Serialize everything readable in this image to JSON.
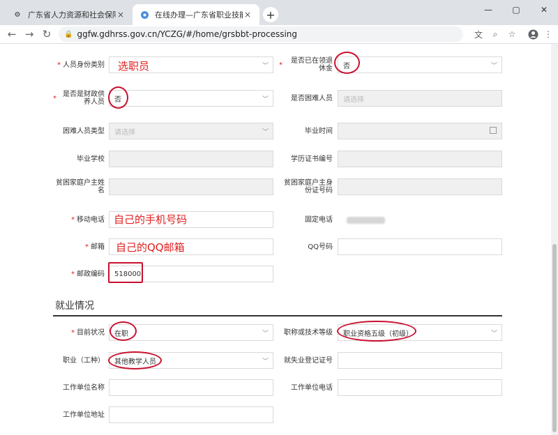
{
  "browser": {
    "tabs": [
      {
        "title": "广东省人力资源和社会保障厅网...",
        "icon": "gear-icon",
        "active": false
      },
      {
        "title": "在线办理—广东省职业技能提升...",
        "icon": "flower-icon",
        "active": true
      }
    ],
    "url": "ggfw.gdhrss.gov.cn/YCZG/#/home/grsbbt-processing"
  },
  "form": {
    "rows": [
      {
        "left": {
          "label": "人员身份类别",
          "required": true,
          "value": "",
          "placeholder": "",
          "type": "select"
        },
        "right": {
          "label": "是否已在领退休金",
          "required": true,
          "value": "否",
          "type": "select"
        }
      },
      {
        "left": {
          "label": "是否是财政供养人员",
          "required": true,
          "value": "否",
          "type": "select"
        },
        "right": {
          "label": "是否困难人员",
          "required": false,
          "value": "",
          "placeholder": "请选择",
          "type": "select",
          "disabled": true
        }
      },
      {
        "left": {
          "label": "困难人员类型",
          "required": false,
          "value": "",
          "placeholder": "请选择",
          "type": "select",
          "disabled": true
        },
        "right": {
          "label": "毕业时间",
          "required": false,
          "value": "",
          "type": "date",
          "disabled": true
        }
      },
      {
        "left": {
          "label": "毕业学校",
          "required": false,
          "value": "",
          "type": "text",
          "disabled": true
        },
        "right": {
          "label": "学历证书编号",
          "required": false,
          "value": "",
          "type": "text",
          "disabled": true
        }
      },
      {
        "left": {
          "label": "贫困家庭户主姓名",
          "required": false,
          "value": "",
          "type": "text",
          "disabled": true
        },
        "right": {
          "label": "贫困家庭户主身份证号码",
          "required": false,
          "value": "",
          "type": "text",
          "disabled": true
        }
      },
      {
        "left": {
          "label": "移动电话",
          "required": true,
          "value": "",
          "type": "text"
        },
        "right": {
          "label": "固定电话",
          "required": false,
          "value": "",
          "type": "text"
        }
      },
      {
        "left": {
          "label": "邮箱",
          "required": true,
          "value": "",
          "type": "text"
        },
        "right": {
          "label": "QQ号码",
          "required": false,
          "value": "",
          "type": "text"
        }
      },
      {
        "left": {
          "label": "邮政编码",
          "required": true,
          "value": "518000",
          "type": "text"
        }
      }
    ],
    "section_title": "就业情况",
    "employment_rows": [
      {
        "left": {
          "label": "目前状况",
          "required": true,
          "value": "在职",
          "type": "select"
        },
        "right": {
          "label": "职称或技术等级",
          "required": false,
          "value": "职业资格五级（初级）",
          "type": "select"
        }
      },
      {
        "left": {
          "label": "职业（工种）",
          "required": false,
          "value": "其他教学人员",
          "type": "select"
        },
        "right": {
          "label": "就失业登记证号",
          "required": false,
          "value": "",
          "type": "text"
        }
      },
      {
        "left": {
          "label": "工作单位名称",
          "required": false,
          "value": "",
          "type": "text"
        },
        "right": {
          "label": "工作单位电话",
          "required": false,
          "value": "",
          "type": "text"
        }
      },
      {
        "left": {
          "label": "工作单位地址",
          "required": false,
          "value": "",
          "type": "text"
        }
      }
    ]
  },
  "annotations": {
    "identity": "选职员",
    "mobile": "自己的手机号码",
    "email": "自己的QQ邮箱"
  },
  "colors": {
    "required": "#e02020",
    "annotation": "#c8102e",
    "tabbar": "#dee1e6"
  }
}
